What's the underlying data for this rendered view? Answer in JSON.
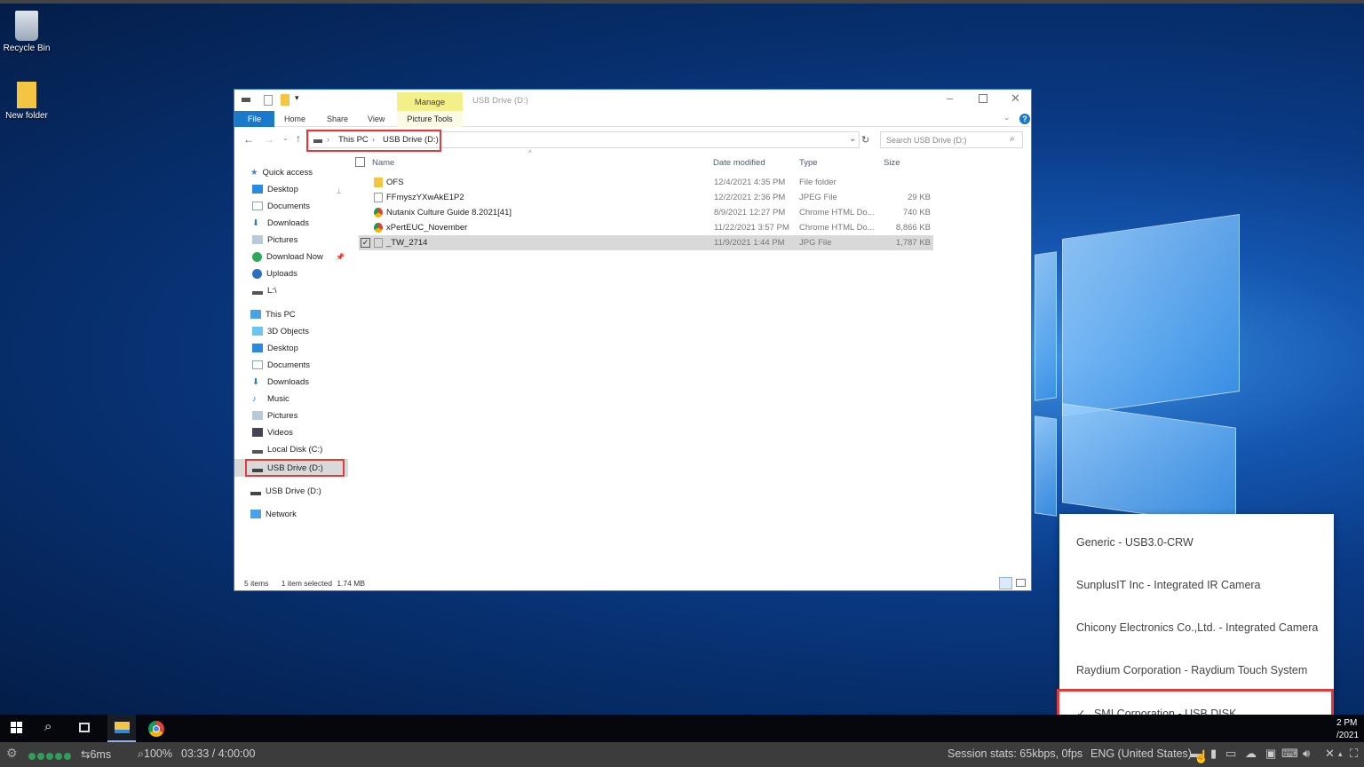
{
  "desktop": {
    "icons": [
      {
        "label": "Recycle Bin",
        "icon": "recycle-bin-icon"
      },
      {
        "label": "New folder",
        "icon": "folder-icon"
      }
    ]
  },
  "explorer": {
    "title": "USB Drive (D:)",
    "contextual_tab": "Manage",
    "contextual_group": "Picture Tools",
    "ribbon_tabs": [
      "File",
      "Home",
      "Share",
      "View"
    ],
    "breadcrumb": [
      "This PC",
      "USB Drive (D:)"
    ],
    "search_placeholder": "Search USB Drive (D:)",
    "columns": {
      "name": "Name",
      "date": "Date modified",
      "type": "Type",
      "size": "Size"
    },
    "files": [
      {
        "name": "OFS",
        "date": "12/4/2021 4:35 PM",
        "type": "File folder",
        "size": "",
        "icon": "folder-icon"
      },
      {
        "name": "FFmyszYXwAkE1P2",
        "date": "12/2/2021 2:36 PM",
        "type": "JPEG File",
        "size": "29 KB",
        "icon": "image-file-icon"
      },
      {
        "name": "Nutanix Culture Guide 8.2021[41]",
        "date": "8/9/2021 12:27 PM",
        "type": "Chrome HTML Do...",
        "size": "740 KB",
        "icon": "chrome-icon"
      },
      {
        "name": "xPertEUC_November",
        "date": "11/22/2021 3:57 PM",
        "type": "Chrome HTML Do...",
        "size": "8,866 KB",
        "icon": "chrome-icon"
      },
      {
        "name": "_TW_2714",
        "date": "11/9/2021 1:44 PM",
        "type": "JPG File",
        "size": "1,787 KB",
        "icon": "image-file-icon",
        "selected": true
      }
    ],
    "nav": {
      "quick_access": "Quick access",
      "quick_items": [
        "Desktop",
        "Documents",
        "Downloads",
        "Pictures",
        "Download Now",
        "Uploads",
        "L:\\"
      ],
      "this_pc": "This PC",
      "pc_items": [
        "3D Objects",
        "Desktop",
        "Documents",
        "Downloads",
        "Music",
        "Pictures",
        "Videos",
        "Local Disk (C:)",
        "USB Drive (D:)"
      ],
      "usb": "USB Drive (D:)",
      "network": "Network"
    },
    "status": {
      "items": "5 items",
      "selected": "1 item selected",
      "size": "1.74 MB"
    }
  },
  "usb_menu": {
    "items": [
      {
        "label": "Generic - USB3.0-CRW",
        "checked": false
      },
      {
        "label": "SunplusIT Inc - Integrated IR Camera",
        "checked": false
      },
      {
        "label": "Chicony Electronics Co.,Ltd. - Integrated Camera",
        "checked": false
      },
      {
        "label": "Raydium Corporation - Raydium Touch System",
        "checked": false
      },
      {
        "label": "SMI Corporation - USB DISK",
        "checked": true
      }
    ],
    "check": "✓"
  },
  "clock": {
    "time": "2 PM",
    "date": "/2021"
  },
  "session_bar": {
    "latency": "6ms",
    "zoom": "100%",
    "elapsed": "03:33 / 4:00:00",
    "stats": "Session stats: 65kbps, 0fps",
    "language": "ENG (United States)",
    "quality_dots": 5
  },
  "colors": {
    "accent": "#1979ca",
    "highlight": "#e03a3a",
    "manage_tab": "#f3f08a"
  }
}
